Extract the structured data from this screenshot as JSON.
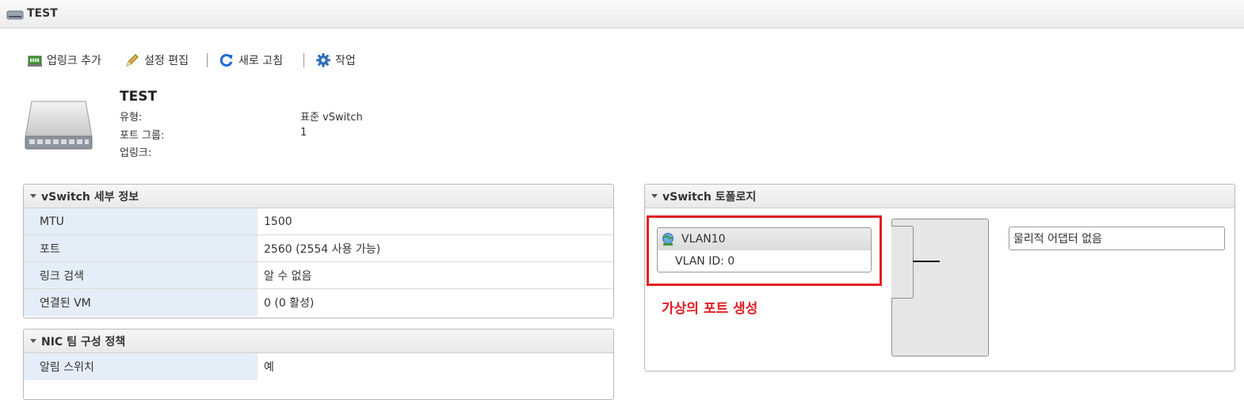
{
  "window": {
    "title": "TEST"
  },
  "toolbar": {
    "add_uplink": "업링크 추가",
    "edit_settings": "설정 편집",
    "refresh": "새로 고침",
    "actions": "작업"
  },
  "summary": {
    "name": "TEST",
    "fields": [
      {
        "label": "유형:",
        "value": "표준 vSwitch"
      },
      {
        "label": "포트 그룹:",
        "value": "1"
      },
      {
        "label": "업링크:",
        "value": ""
      }
    ]
  },
  "details_panel": {
    "title": "vSwitch 세부 정보",
    "rows": [
      {
        "key": "MTU",
        "value": "1500"
      },
      {
        "key": "포트",
        "value": "2560 (2554 사용 가능)"
      },
      {
        "key": "링크 검색",
        "value": "알 수 없음"
      },
      {
        "key": "연결된 VM",
        "value": "0 (0 활성)"
      }
    ]
  },
  "nic_panel": {
    "title": "NIC 팀 구성 정책",
    "rows": [
      {
        "key": "알림 스위치",
        "value": "예"
      }
    ]
  },
  "topology": {
    "title": "vSwitch 토폴로지",
    "port_group": {
      "name": "VLAN10",
      "vlan": "VLAN ID: 0"
    },
    "physical": "물리적 어댑터 없음",
    "annotation": "가상의 포트 생성"
  },
  "colors": {
    "highlight": "#e31e24",
    "key_column_bg": "#e4eef8",
    "accent_icon": "#1e6bd6"
  },
  "icons": [
    "switch-icon",
    "uplink-icon",
    "pencil-icon",
    "refresh-icon",
    "gear-icon",
    "virtual-switch-icon",
    "globe-icon",
    "caret-down-icon"
  ]
}
